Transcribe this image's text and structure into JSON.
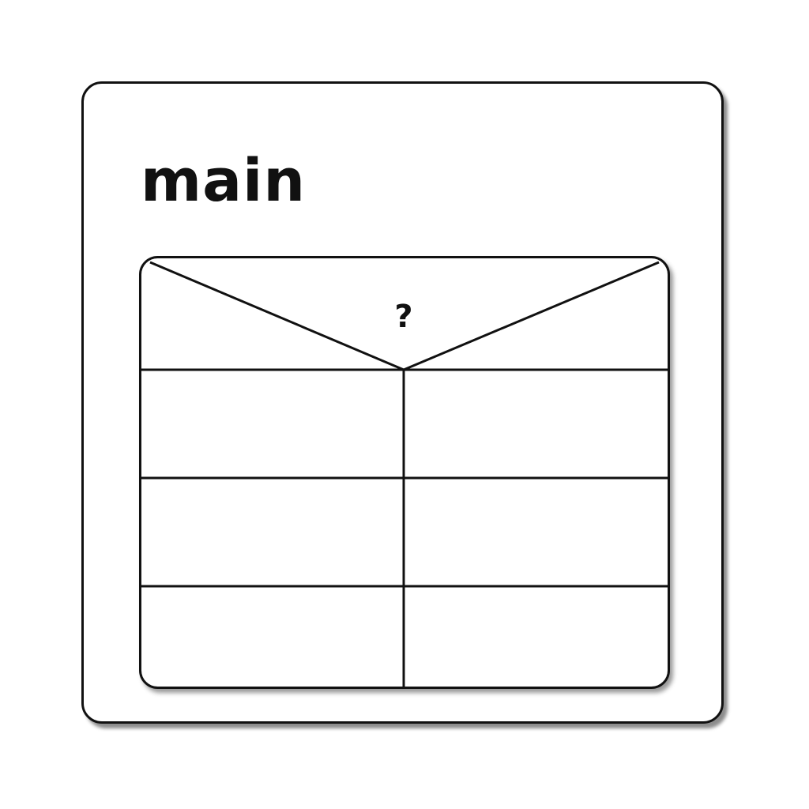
{
  "title": "main",
  "decision": {
    "label": "?"
  },
  "table": {
    "rows": [
      [
        "",
        ""
      ],
      [
        "",
        ""
      ],
      [
        "",
        ""
      ]
    ]
  },
  "colors": {
    "stroke": "#111111",
    "background": "#ffffff"
  },
  "icons": {
    "decision_marker": "question-mark-glyph"
  }
}
